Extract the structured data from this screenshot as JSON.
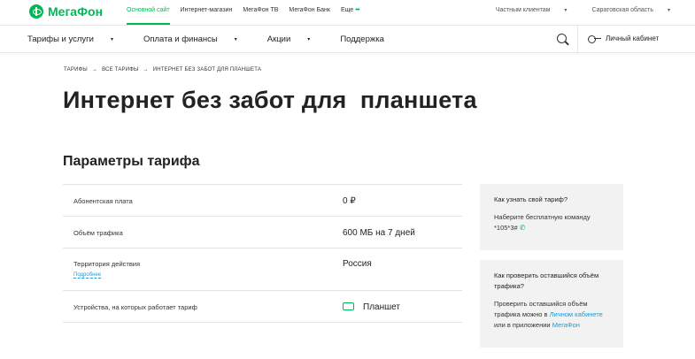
{
  "header": {
    "logo_text": "МегаФон",
    "top_links": [
      "Основной сайт",
      "Интернет-магазин",
      "МегаФон ТВ",
      "МегаФон Банк",
      "Еще"
    ],
    "more_dots": "•••",
    "client_type": "Частным клиентам",
    "region": "Саратовская область"
  },
  "nav": {
    "items": [
      "Тарифы и услуги",
      "Оплата и финансы",
      "Акции",
      "Поддержка"
    ],
    "cabinet_label": "Личный кабинет"
  },
  "breadcrumb": [
    "ТАРИФЫ",
    "ВСЕ ТАРИФЫ",
    "ИНТЕРНЕТ БЕЗ ЗАБОТ ДЛЯ ПЛАНШЕТА"
  ],
  "breadcrumb_sep": "→",
  "page_title": "Интернет без забот для  планшета",
  "section_title": "Параметры тарифа",
  "params": [
    {
      "name": "Абонентская плата",
      "value": "0 ₽"
    },
    {
      "name": "Объём трафика",
      "value": "600 МБ на 7 дней"
    },
    {
      "name": "Территория действия",
      "value": "Россия",
      "link": "Подробнее"
    },
    {
      "name": "Устройства, на которых работает тариф",
      "value": "Планшет"
    }
  ],
  "card1": {
    "question": "Как узнать свой тариф?",
    "text": "Наберите бесплатную команду",
    "command": "*105*3#"
  },
  "card2": {
    "question": "Как проверить оставшийся объём трафика?",
    "text1": "Проверить оставшийся объём трафика можно в",
    "link1": "Личном кабинете",
    "text2": "или в приложении",
    "link2": "МегаФон"
  },
  "colors": {
    "brand": "#00b956",
    "link": "#1f9ad6"
  }
}
